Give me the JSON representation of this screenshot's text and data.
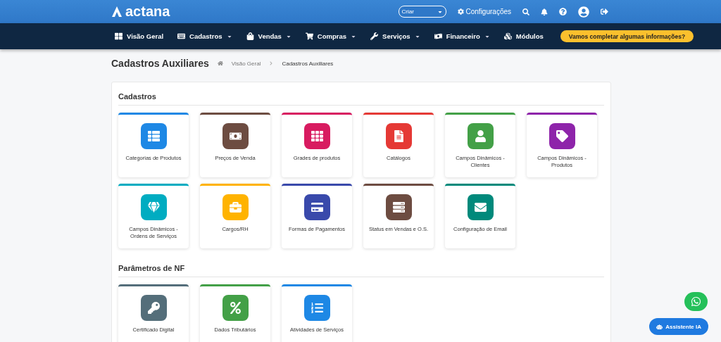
{
  "topbar": {
    "logo": "actana",
    "create_select": {
      "value": "Criar"
    },
    "settings_link": "Configurações"
  },
  "nav": {
    "items": [
      {
        "label": "Visão Geral",
        "dropdown": false
      },
      {
        "label": "Cadastros",
        "dropdown": true
      },
      {
        "label": "Vendas",
        "dropdown": true
      },
      {
        "label": "Compras",
        "dropdown": true
      },
      {
        "label": "Serviços",
        "dropdown": true
      },
      {
        "label": "Financeiro",
        "dropdown": true
      },
      {
        "label": "Módulos",
        "dropdown": false
      }
    ],
    "cta": "Vamos completar algumas informações?"
  },
  "page": {
    "title": "Cadastros Auxiliares",
    "breadcrumb": [
      "Visão Geral",
      "Cadastros Auxiliares"
    ]
  },
  "sections": [
    {
      "title": "Cadastros",
      "tiles": [
        {
          "label": "Categorias de Produtos",
          "color": "#1e88e5"
        },
        {
          "label": "Preços de Venda",
          "color": "#6d4c41"
        },
        {
          "label": "Grades de produtos",
          "color": "#d81b60"
        },
        {
          "label": "Catálogos",
          "color": "#e53935"
        },
        {
          "label": "Campos Dinâmicos - Clientes",
          "color": "#43a047"
        },
        {
          "label": "Campos Dinâmicos - Produtos",
          "color": "#8e24aa"
        },
        {
          "label": "Campos Dinâmicos - Ordens de Serviços",
          "color": "#00acc1"
        },
        {
          "label": "Cargos/RH",
          "color": "#ffb300"
        },
        {
          "label": "Formas de Pagamentos",
          "color": "#3949ab"
        },
        {
          "label": "Status em Vendas e O.S.",
          "color": "#6d4c41"
        },
        {
          "label": "Configuração de Email",
          "color": "#00897b"
        }
      ]
    },
    {
      "title": "Parâmetros de NF",
      "tiles": [
        {
          "label": "Certificado Digital",
          "color": "#546e7a"
        },
        {
          "label": "Dados Tributários",
          "color": "#43a047"
        },
        {
          "label": "Atividades de Serviços",
          "color": "#1e88e5"
        }
      ]
    }
  ],
  "assistant_button": "Assistente IA"
}
